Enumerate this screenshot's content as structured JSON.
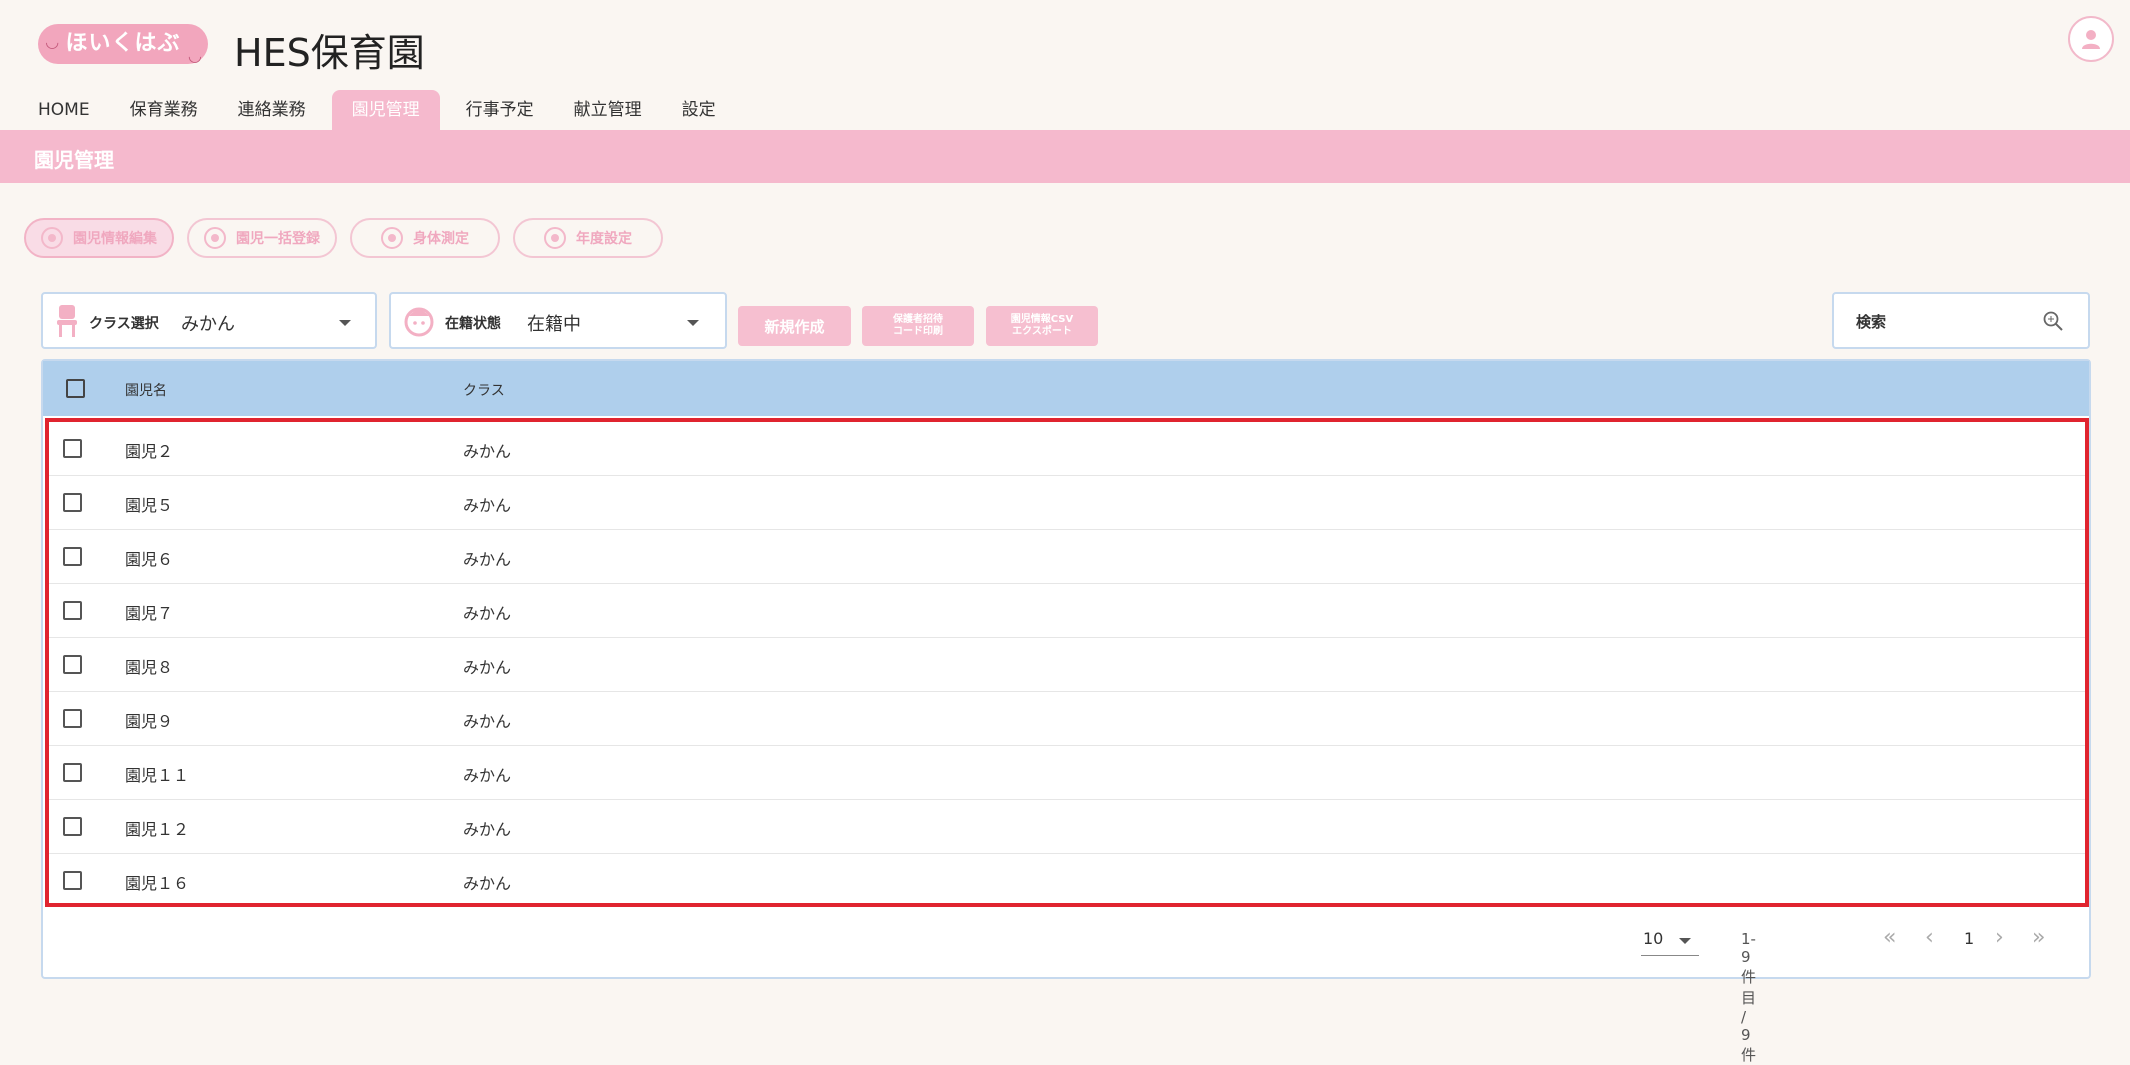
{
  "header": {
    "logo_text": "ほいくはぶ",
    "org_name": "HES保育園"
  },
  "nav": {
    "tabs": [
      "HOME",
      "保育業務",
      "連絡業務",
      "園児管理",
      "行事予定",
      "献立管理",
      "設定"
    ],
    "active": "園児管理"
  },
  "section": {
    "title": "園児管理"
  },
  "sub_buttons": [
    "園児情報編集",
    "園児一括登録",
    "身体測定",
    "年度設定"
  ],
  "filters": {
    "class_label": "クラス選択",
    "class_value": "みかん",
    "status_label": "在籍状態",
    "status_value": "在籍中"
  },
  "actions": {
    "new": "新規作成",
    "print_line1": "保護者招待",
    "print_line2": "コード印刷",
    "export_line1": "園児情報CSV",
    "export_line2": "エクスポート"
  },
  "search": {
    "placeholder": "検索"
  },
  "table": {
    "headers": {
      "name": "園児名",
      "class": "クラス"
    },
    "rows": [
      {
        "name": "園児２",
        "class": "みかん"
      },
      {
        "name": "園児５",
        "class": "みかん"
      },
      {
        "name": "園児６",
        "class": "みかん"
      },
      {
        "name": "園児７",
        "class": "みかん"
      },
      {
        "name": "園児８",
        "class": "みかん"
      },
      {
        "name": "園児９",
        "class": "みかん"
      },
      {
        "name": "園児１１",
        "class": "みかん"
      },
      {
        "name": "園児１２",
        "class": "みかん"
      },
      {
        "name": "園児１６",
        "class": "みかん"
      }
    ]
  },
  "pagination": {
    "per_page": "10",
    "range": "1-9 件目 / 9件",
    "first": "«",
    "prev": "‹",
    "page": "1",
    "next": "›",
    "last": "»"
  },
  "colors": {
    "accent_pink": "#f5b9cd",
    "header_blue": "#afcfec",
    "highlight_red": "#e0242f"
  }
}
